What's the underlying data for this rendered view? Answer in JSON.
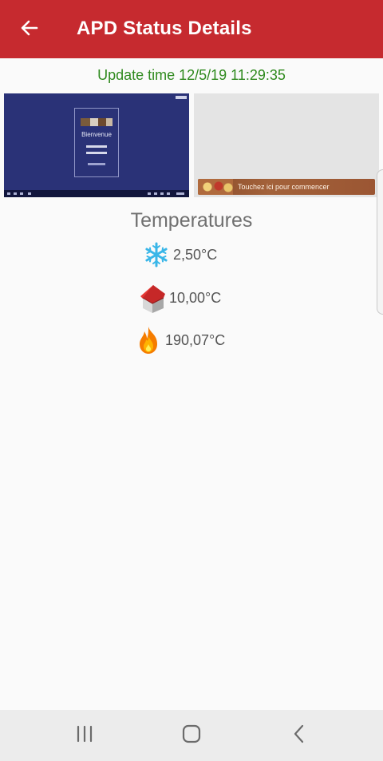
{
  "appbar": {
    "title": "APD Status Details",
    "back_icon": "arrow-left-icon",
    "color": "#c62a2f"
  },
  "update": {
    "text": "Update time 12/5/19 11:29:35",
    "color": "#2f8a1e"
  },
  "screenshots": {
    "left": {
      "login_title": "Bienvenue"
    },
    "right": {
      "banner_text": "Touchez ici pour commencer"
    }
  },
  "temperatures": {
    "title": "Temperatures",
    "items": [
      {
        "icon": "snowflake-icon",
        "value": "2,50°C"
      },
      {
        "icon": "house-icon",
        "value": "10,00°C"
      },
      {
        "icon": "flame-icon",
        "value": "190,07°C"
      }
    ]
  },
  "navbar": {
    "recent_icon": "recent-apps-icon",
    "home_icon": "home-icon",
    "back_icon": "back-chevron-icon"
  }
}
